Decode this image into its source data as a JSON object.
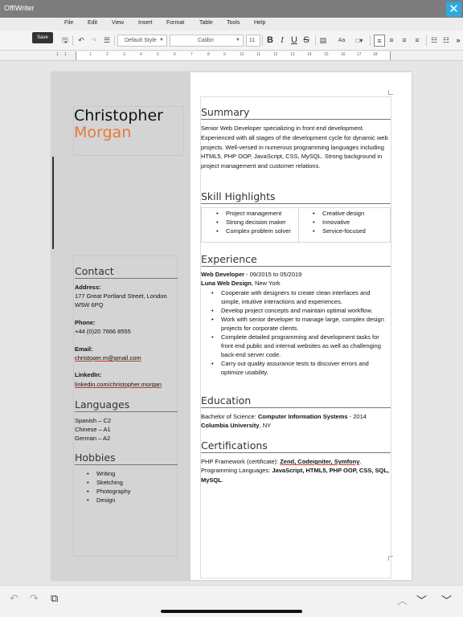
{
  "app": {
    "title": "OffiWriter"
  },
  "menu": [
    "File",
    "Edit",
    "View",
    "Insert",
    "Format",
    "Table",
    "Tools",
    "Help"
  ],
  "toolbar": {
    "save_tooltip": "Save",
    "style_value": "Default Style",
    "font_value": "Calibri",
    "size_value": "11",
    "bold": "B",
    "italic": "I",
    "underline": "U",
    "strike": "S",
    "font_size_btn": "Aa"
  },
  "ruler": [
    "1",
    "1",
    "1",
    "2",
    "3",
    "4",
    "5",
    "6",
    "7",
    "8",
    "9",
    "10",
    "11",
    "12",
    "13",
    "14",
    "15",
    "16",
    "17",
    "18"
  ],
  "resume": {
    "first_name": "Christopher",
    "last_name": "Morgan",
    "contact_title": "Contact",
    "address_label": "Address:",
    "address_line1": "177 Great Portland Street, London",
    "address_line2": "W5W 6PQ",
    "phone_label": "Phone:",
    "phone": "+44 (0)20 7666 8555",
    "email_label": "Email:",
    "email": "christoper.m@gmail.com",
    "linkedin_label": "LinkedIn:",
    "linkedin": "linkedin.com/christopher.morgan",
    "languages_title": "Languages",
    "languages": [
      "Spanish – C2",
      "Chinese – A1",
      "German – A2"
    ],
    "hobbies_title": "Hobbies",
    "hobbies": [
      "Writing",
      "Sketching",
      "Photography",
      "Design"
    ],
    "summary_title": "Summary",
    "summary_text": "Senior Web Developer specializing in front end development. Experienced with all stages of the development cycle for dynamic web projects. Well-versed in numerous programming languages including HTML5, PHP OOP, JavaScript, CSS, MySQL. Strong background in project management and customer relations.",
    "skills_title": "Skill Highlights",
    "skills_left": [
      "Project management",
      "Strong decision maker",
      "Complex problem solver"
    ],
    "skills_right": [
      "Creative design",
      "Innovative",
      "Service-focused"
    ],
    "experience_title": "Experience",
    "job_title": "Web Developer",
    "job_dates": " - 09/2015 to 05/2019",
    "company": "Luna Web Design",
    "company_location": ", New York",
    "job_points": [
      "Cooperate with designers to create clean interfaces and simple, intuitive interactions and experiences.",
      "Develop project concepts and maintain optimal workflow.",
      "Work with senior developer to manage large, complex design projects for corporate clients.",
      "Complete detailed programming and development tasks for front end public and internal websites as well as challenging back-end server code.",
      "Carry out quality assurance tests to discover errors and optimize usability."
    ],
    "education_title": "Education",
    "degree_prefix": "Bachelor of Science: ",
    "degree_field": "Computer Information Systems",
    "degree_year": " - 2014",
    "university": "Columbia University",
    "university_location": ", NY",
    "certs_title": "Certifications",
    "cert_line1_prefix": "PHP Framework (certificate): ",
    "cert_line1_items": "Zend, Codeigniter, Symfony",
    "cert_line1_suffix": ".",
    "cert_line2_prefix": "Programming Languages: ",
    "cert_line2_items": "JavaScript, HTML5, PHP OOP, CSS, SQL, MySQL",
    "cert_line2_suffix": "."
  },
  "colors": {
    "accent_name": "#e9783a",
    "titlebar": "#7d7d7d",
    "close": "#2fa8e0"
  }
}
